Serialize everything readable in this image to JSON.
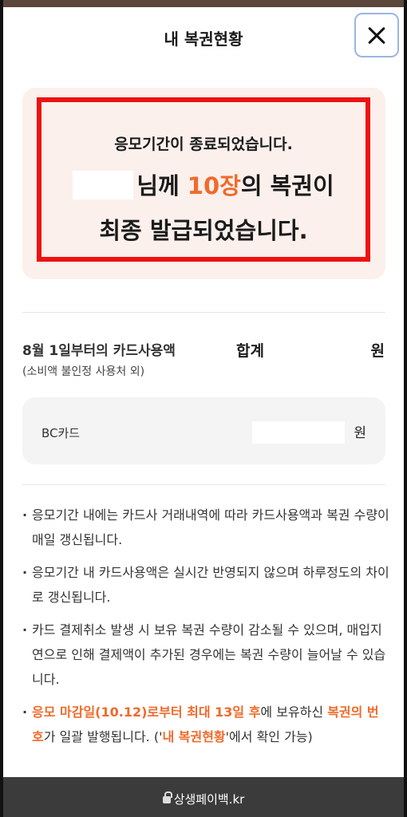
{
  "header": {
    "title": "내 복권현황"
  },
  "notice": {
    "line1": "응모기간이 종료되었습니다.",
    "line2_prefix": "님께 ",
    "count": "10장",
    "line2_suffix": "의 복권이",
    "line3": "최종 발급되었습니다."
  },
  "usage": {
    "label": "8월 1일부터의 카드사용액",
    "sub": "(소비액 불인정 사용처 외)",
    "total_label": "합계",
    "unit": "원"
  },
  "card": {
    "name": "BC카드",
    "unit": "원"
  },
  "notes": [
    "응모기간 내에는 카드사 거래내역에 따라 카드사용액과 복권 수량이 매일 갱신됩니다.",
    "응모기간 내 카드사용액은 실시간 반영되지 않으며 하루정도의 차이로 갱신됩니다.",
    "카드 결제취소 발생 시 보유 복권 수량이 감소될 수 있으며, 매입지연으로 인해 결제액이 추가된 경우에는 복권 수량이 늘어날 수 있습니다."
  ],
  "note4": {
    "hl1": "응모 마감일(10.12)로부터 최대 13일 후",
    "t1": "에 보유하신 ",
    "hl2": "복권의 번호",
    "t2": "가 일괄 발행됩니다. ('",
    "hl3": "내 복권현황",
    "t3": "'에서 확인 가능)"
  },
  "browser": {
    "url": "상생페이백.kr"
  },
  "colors": {
    "accent": "#f06a2b",
    "alert_border": "#ee1111",
    "card_bg": "#fbf0ec"
  }
}
